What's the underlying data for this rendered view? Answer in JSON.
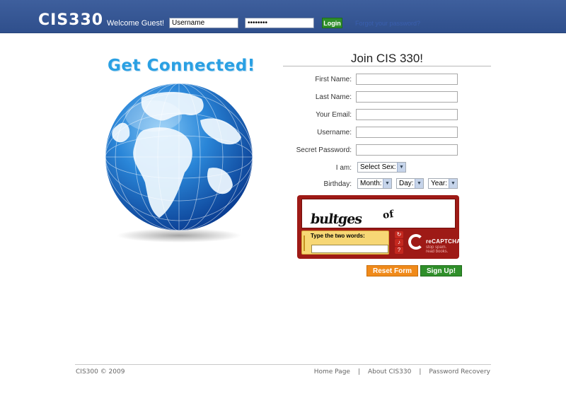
{
  "header": {
    "logo": "CIS330",
    "welcome": "Welcome Guest!",
    "username_value": "Username",
    "password_value": "••••••••",
    "login_label": "Login",
    "forgot_link": "Forgot your password?"
  },
  "promo": {
    "headline": "Get Connected!"
  },
  "form": {
    "title": "Join CIS 330!",
    "fields": {
      "first_name": "First Name:",
      "last_name": "Last Name:",
      "email": "Your Email:",
      "username": "Username:",
      "password": "Secret Password:",
      "sex": "I am:",
      "birthday": "Birthday:"
    },
    "sex_select": "Select Sex:",
    "month_select": "Month:",
    "day_select": "Day:",
    "year_select": "Year:",
    "reset_label": "Reset Form",
    "signup_label": "Sign Up!"
  },
  "captcha": {
    "word1": "bultges",
    "word2": "of",
    "prompt": "Type the two words:",
    "brand": "reCAPTCHA™",
    "tagline1": "stop spam.",
    "tagline2": "read books."
  },
  "footer": {
    "copyright": "CIS300 © 2009",
    "links": [
      "Home Page",
      "About CIS330",
      "Password Recovery"
    ],
    "separator": "|"
  },
  "colors": {
    "header_bg": "#2f4f8c",
    "accent_blue": "#2aa0e3",
    "login_green": "#2f8f2a",
    "reset_orange": "#f08a1a",
    "captcha_red": "#9e1a16"
  }
}
